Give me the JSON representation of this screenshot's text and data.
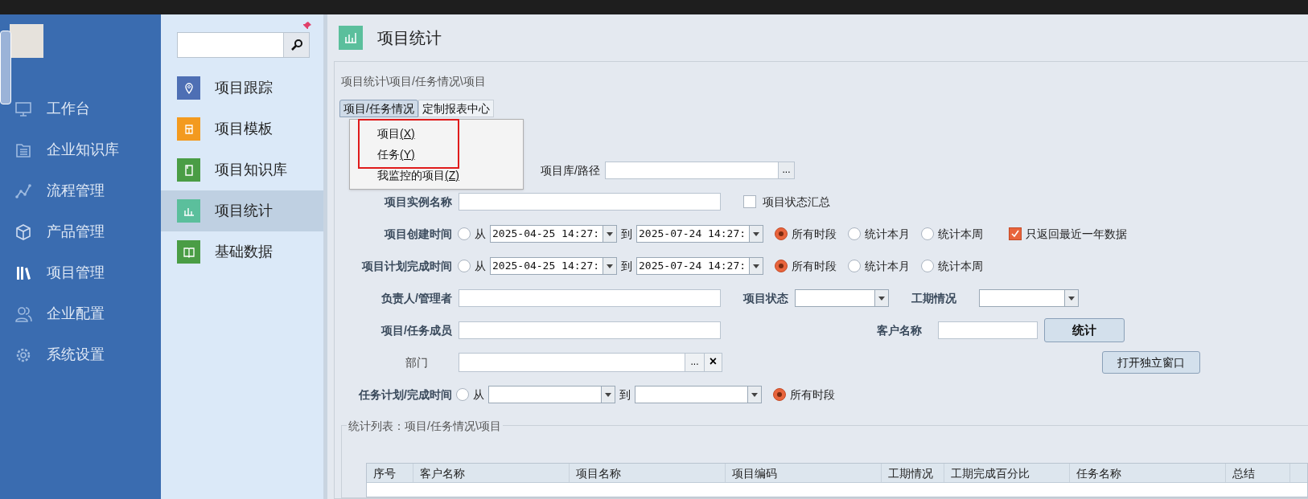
{
  "nav": [
    {
      "label": "工作台"
    },
    {
      "label": "企业知识库"
    },
    {
      "label": "流程管理"
    },
    {
      "label": "产品管理"
    },
    {
      "label": "项目管理"
    },
    {
      "label": "企业配置"
    },
    {
      "label": "系统设置"
    }
  ],
  "subnav": [
    {
      "label": "项目跟踪",
      "color": "#4e6fb4",
      "selected": false
    },
    {
      "label": "项目模板",
      "color": "#f39a1f",
      "selected": false
    },
    {
      "label": "项目知识库",
      "color": "#4a9d45",
      "selected": false
    },
    {
      "label": "项目统计",
      "color": "#5bbf9c",
      "selected": true
    },
    {
      "label": "基础数据",
      "color": "#4a9d45",
      "selected": false
    }
  ],
  "page_title": "项目统计",
  "breadcrumb": "项目统计\\项目/任务情况\\项目",
  "tabs": [
    {
      "label": "项目/任务情况",
      "selected": true
    },
    {
      "label": "定制报表中心",
      "selected": false
    }
  ],
  "menu": [
    {
      "label": "项目",
      "accel": "(X)",
      "highlighted": true
    },
    {
      "label": "任务",
      "accel": "(Y)",
      "highlighted": true
    },
    {
      "label": "我监控的项目",
      "accel": "(Z)"
    }
  ],
  "form": {
    "library_label": "项目库/路径",
    "instance_label": "项目实例名称",
    "status_summary": {
      "label": "项目状态汇总",
      "checked": false
    },
    "time_rows": [
      {
        "label": "项目创建时间",
        "from": "从",
        "start": "2025-04-25 14:27:",
        "to": "到",
        "end": "2025-07-24 14:27:",
        "options": [
          {
            "label": "所有时段",
            "selected": true
          },
          {
            "label": "统计本月",
            "selected": false
          },
          {
            "label": "统计本周",
            "selected": false
          }
        ],
        "range_selected": false,
        "extra": {
          "label": "只返回最近一年数据",
          "checked": true
        }
      },
      {
        "label": "项目计划完成时间",
        "from": "从",
        "start": "2025-04-25 14:27:",
        "to": "到",
        "end": "2025-07-24 14:27:",
        "options": [
          {
            "label": "所有时段",
            "selected": true
          },
          {
            "label": "统计本月",
            "selected": false
          },
          {
            "label": "统计本周",
            "selected": false
          }
        ],
        "range_selected": false
      }
    ],
    "manager_label": "负责人/管理者",
    "status_label": "项目状态",
    "period_label": "工期情况",
    "member_label": "项目/任务成员",
    "customer_label": "客户名称",
    "stat_button": "统计",
    "dept_label": "部门",
    "dept_browse": "...",
    "dept_clear": "×",
    "window_button": "打开独立窗口",
    "task_time": {
      "label": "任务计划/完成时间",
      "from": "从",
      "to": "到",
      "options": [
        {
          "label": "所有时段",
          "selected": true
        }
      ],
      "range_selected": false
    }
  },
  "list_title": "统计列表：项目/任务情况\\项目",
  "table": {
    "columns": [
      "序号",
      "客户名称",
      "项目名称",
      "项目编码",
      "工期情况",
      "工期完成百分比",
      "任务名称",
      "总结"
    ]
  }
}
